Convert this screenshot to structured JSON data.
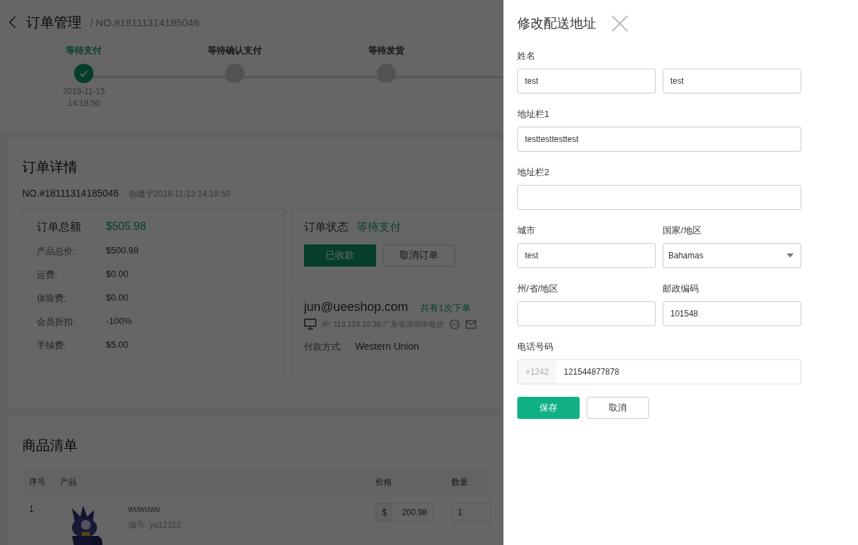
{
  "header": {
    "title": "订单管理",
    "order_no": "/ NO.#18111314185046"
  },
  "steps": [
    {
      "label": "等待支付",
      "done": true,
      "date": "2018-11-13",
      "time": "14:18:50"
    },
    {
      "label": "等待确认支付",
      "done": false
    },
    {
      "label": "等待发货",
      "done": false
    }
  ],
  "order_details": {
    "title": "订单详情",
    "number": "NO.#18111314185046",
    "created": "创建于2018-11-13 14:18:50",
    "total": {
      "label": "订单总额",
      "value": "$505.98"
    },
    "lines": [
      {
        "label": "产品总价:",
        "value": "$500.98"
      },
      {
        "label": "运费:",
        "value": "$0.00"
      },
      {
        "label": "保险费:",
        "value": "$0.00"
      },
      {
        "label": "会员折扣:",
        "value": "-100%"
      },
      {
        "label": "手续费:",
        "value": "$5.00"
      }
    ],
    "status": {
      "label": "订单状态",
      "value": "等待支付",
      "buttons": [
        {
          "label": "已收款",
          "kind": "primary"
        },
        {
          "label": "取消订单",
          "kind": "default"
        }
      ]
    },
    "customer": {
      "email": "jun@ueeshop.com",
      "orders": "共有1次下单",
      "ip": "IP: 113.119.10.38 广东省深圳市电信",
      "payment_label": "付款方式:",
      "payment_value": "Western Union"
    }
  },
  "products": {
    "title": "商品清单",
    "columns": [
      "序号",
      "产品",
      "价格",
      "数量"
    ],
    "rows": [
      {
        "index": "1",
        "name": "wuwuwu",
        "sku": "编号: ya12312",
        "currency": "$",
        "price": "200.98",
        "qty": "1"
      }
    ]
  },
  "drawer": {
    "title": "修改配送地址",
    "rows": [
      [
        {
          "label": "姓名",
          "kind": "text",
          "value": "test"
        },
        {
          "kind": "text",
          "value": "test"
        }
      ],
      [
        {
          "label": "地址栏1",
          "kind": "text",
          "value": "testtesttesttest"
        }
      ],
      [
        {
          "label": "地址栏2",
          "kind": "text"
        }
      ],
      [
        {
          "label": "城市",
          "kind": "text",
          "value": "test"
        },
        {
          "label": "国家/地区",
          "kind": "select",
          "value": "Bahamas"
        }
      ],
      [
        {
          "label": "州/省/地区",
          "kind": "text"
        },
        {
          "label": "邮政编码",
          "kind": "text",
          "value": "101548"
        }
      ],
      [
        {
          "label": "电话号码",
          "kind": "phone",
          "prefix": "+1242",
          "value": "121544877878"
        }
      ]
    ],
    "buttons": [
      {
        "label": "保存",
        "kind": "primary"
      },
      {
        "label": "取消",
        "kind": "default"
      }
    ]
  }
}
